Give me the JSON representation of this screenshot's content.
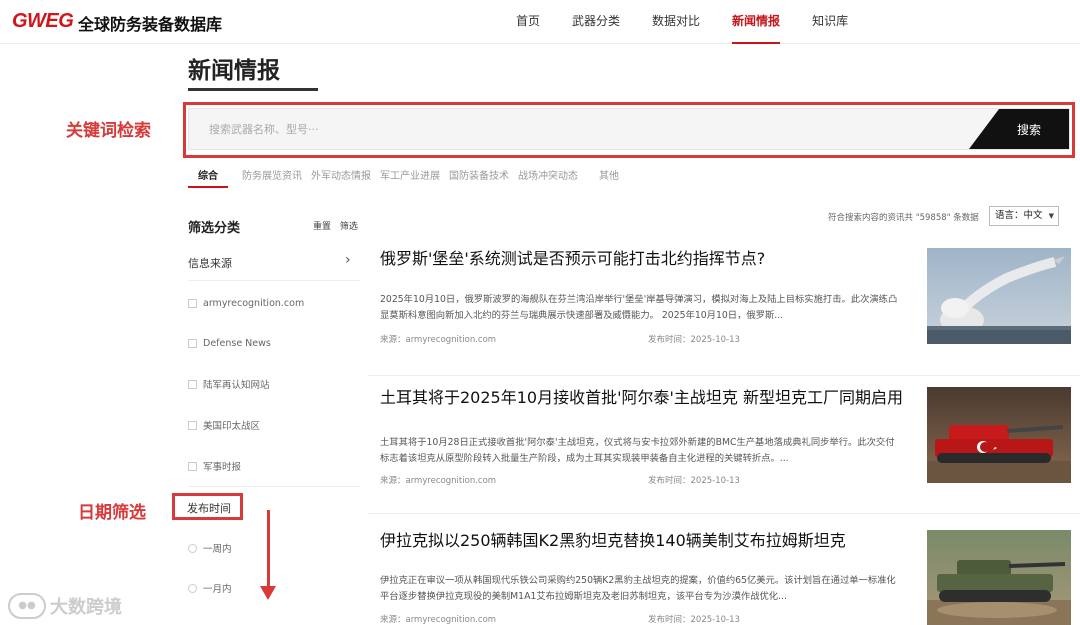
{
  "header": {
    "logo": "GWEG",
    "site_title": "全球防务装备数据库",
    "nav": [
      "首页",
      "武器分类",
      "数据对比",
      "新闻情报",
      "知识库"
    ],
    "active_nav": "新闻情报"
  },
  "page": {
    "title": "新闻情报"
  },
  "search": {
    "placeholder": "搜索武器名称、型号···",
    "button_label": "搜索",
    "annotation": "关键词检索"
  },
  "tabs": [
    "综合",
    "防务展览资讯",
    "外军动态情报",
    "军工产业进展",
    "国防装备技术",
    "战场冲突动态",
    "其他"
  ],
  "sidebar": {
    "title": "筛选分类",
    "reset": "重置",
    "filter": "筛选",
    "source_heading": "信息来源",
    "sources": [
      "armyrecognition.com",
      "Defense News",
      "陆军再认知网站",
      "美国印太战区",
      "军事时报"
    ],
    "date_heading": "发布时间",
    "date_options": [
      "一周内",
      "一月内"
    ],
    "date_annotation": "日期筛选"
  },
  "results": {
    "count_text": "符合搜索内容的资讯共 \"59858\" 条数据",
    "language": "语言：中文"
  },
  "news": [
    {
      "title": "俄罗斯'堡垒'系统测试是否预示可能打击北约指挥节点?",
      "summary": "2025年10月10日，俄罗斯波罗的海舰队在芬兰湾沿岸举行'堡垒'岸基导弹演习，模拟对海上及陆上目标实施打击。此次演练凸显莫斯科意图向新加入北约的芬兰与瑞典展示快速部署及威慑能力。 2025年10月10日，俄罗斯...",
      "source": "来源：armyrecognition.com",
      "date": "发布时间：2025-10-13",
      "image": "missile-launch-image"
    },
    {
      "title": "土耳其将于2025年10月接收首批'阿尔泰'主战坦克 新型坦克工厂同期启用",
      "summary": "土耳其将于10月28日正式接收首批'阿尔泰'主战坦克，仪式将与安卡拉郊外新建的BMC生产基地落成典礼同步举行。此次交付标志着该坦克从原型阶段转入批量生产阶段，成为土耳其实现装甲装备自主化进程的关键转折点。...",
      "source": "来源：armyrecognition.com",
      "date": "发布时间：2025-10-13",
      "image": "tank-turkey-flag-image"
    },
    {
      "title": "伊拉克拟以250辆韩国K2黑豹坦克替换140辆美制艾布拉姆斯坦克",
      "summary": "伊拉克正在审议一项从韩国现代乐铁公司采购约250辆K2黑豹主战坦克的提案，价值约65亿美元。该计划旨在通过单一标准化平台逐步替换伊拉克现役的美制M1A1艾布拉姆斯坦克及老旧苏制坦克，该平台专为沙漠作战优化...",
      "source": "来源：armyrecognition.com",
      "date": "发布时间：2025-10-13",
      "image": "k2-tank-image"
    }
  ],
  "watermark": "大数跨境",
  "colors": {
    "brand_red": "#d0161c",
    "annotation_red": "#d83a3a",
    "search_button": "#111111"
  }
}
